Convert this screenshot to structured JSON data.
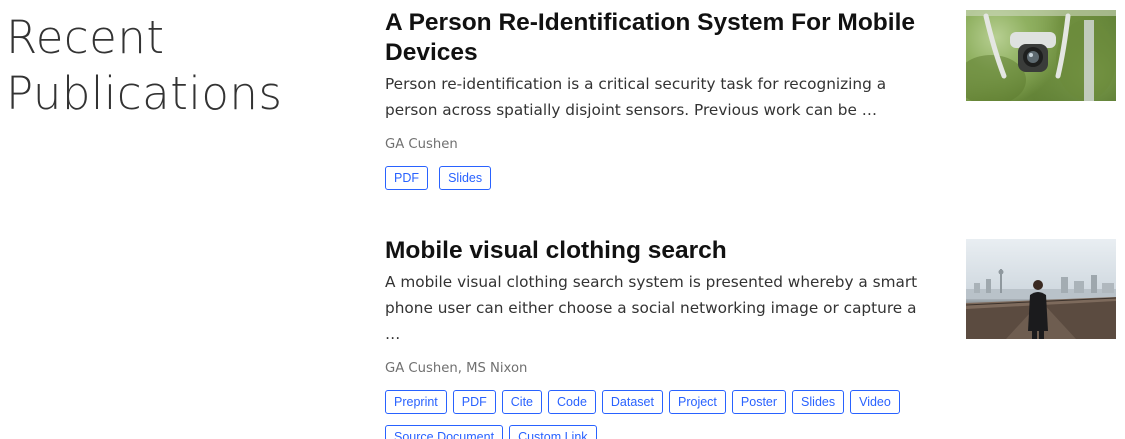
{
  "section": {
    "title": "Recent Publications"
  },
  "publications": [
    {
      "title": "A Person Re-Identification System For Mobile Devices",
      "summary": "Person re-identification is a critical security task for recognizing a person across spatially disjoint sensors. Previous work can be …",
      "authors": "GA Cushen",
      "buttons": [
        "PDF",
        "Slides"
      ],
      "thumbnail": "drone-photo"
    },
    {
      "title": "Mobile visual clothing search",
      "summary": "A mobile visual clothing search system is presented whereby a smart phone user can either choose a social networking image or capture a …",
      "authors": "GA Cushen, MS Nixon",
      "buttons": [
        "Preprint",
        "PDF",
        "Cite",
        "Code",
        "Dataset",
        "Project",
        "Poster",
        "Slides",
        "Video",
        "Source Document",
        "Custom Link"
      ],
      "thumbnail": "city-bridge-photo"
    }
  ],
  "colors": {
    "accent": "#2962ff",
    "title": "#111111",
    "muted": "#707070"
  }
}
